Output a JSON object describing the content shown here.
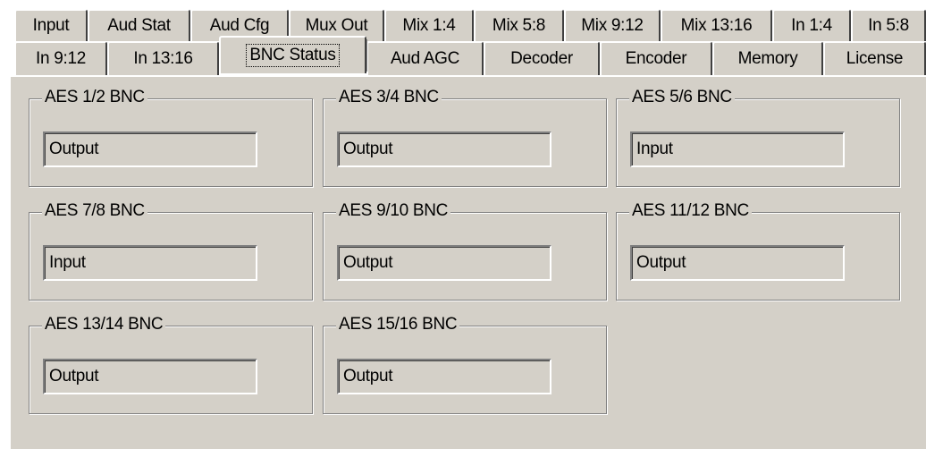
{
  "tabs": {
    "back_row": [
      {
        "label": "Input"
      },
      {
        "label": "Aud Stat"
      },
      {
        "label": "Aud Cfg"
      },
      {
        "label": "Mux Out"
      },
      {
        "label": "Mix 1:4"
      },
      {
        "label": "Mix 5:8"
      },
      {
        "label": "Mix 9:12"
      },
      {
        "label": "Mix 13:16"
      },
      {
        "label": "In 1:4"
      },
      {
        "label": "In 5:8"
      }
    ],
    "front_row": [
      {
        "label": "In 9:12"
      },
      {
        "label": "In 13:16"
      },
      {
        "label": "BNC Status"
      },
      {
        "label": "Aud AGC"
      },
      {
        "label": "Decoder"
      },
      {
        "label": "Encoder"
      },
      {
        "label": "Memory"
      },
      {
        "label": "License"
      }
    ],
    "active_tab": "BNC Status"
  },
  "bnc_groups": [
    {
      "title": "AES 1/2 BNC",
      "status": "Output"
    },
    {
      "title": "AES 3/4 BNC",
      "status": "Output"
    },
    {
      "title": "AES 5/6 BNC",
      "status": "Input"
    },
    {
      "title": "AES 7/8 BNC",
      "status": "Input"
    },
    {
      "title": "AES 9/10 BNC",
      "status": "Output"
    },
    {
      "title": "AES 11/12 BNC",
      "status": "Output"
    },
    {
      "title": "AES 13/14 BNC",
      "status": "Output"
    },
    {
      "title": "AES 15/16 BNC",
      "status": "Output"
    }
  ],
  "colors": {
    "window_face": "#d4d0c8",
    "highlight": "#ffffff",
    "shadow": "#808080",
    "dark_shadow": "#404040"
  }
}
